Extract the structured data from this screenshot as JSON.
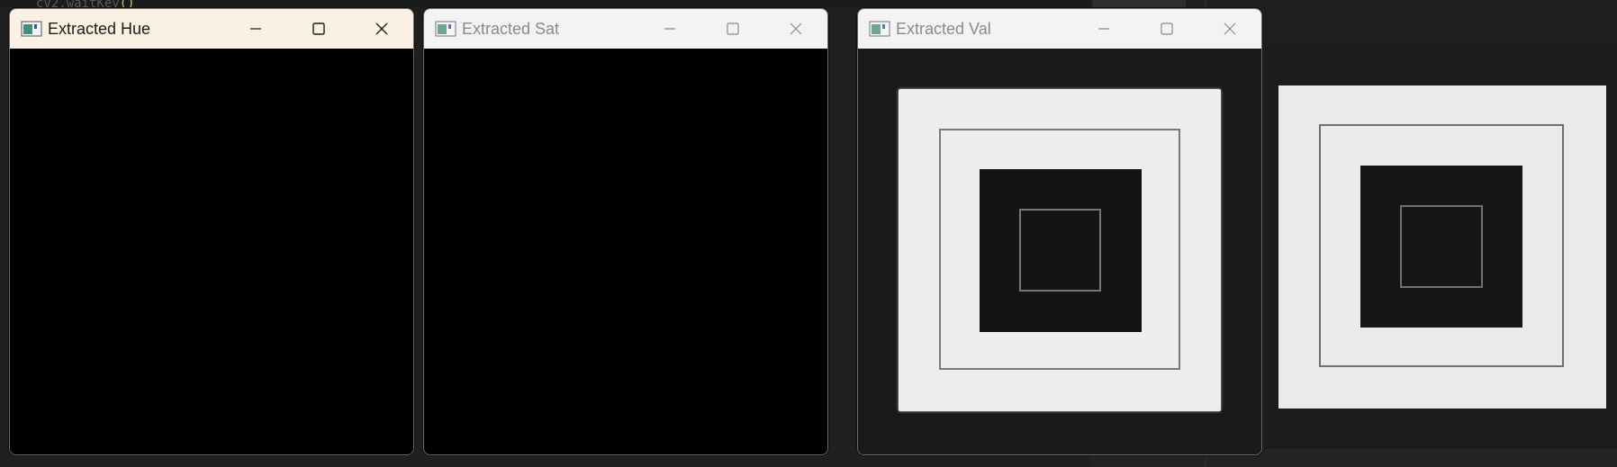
{
  "editor": {
    "code_fragment": "cv2.waitKey",
    "code_suffix": "()"
  },
  "windows": {
    "hue": {
      "title": "Extracted Hue",
      "active": true
    },
    "sat": {
      "title": "Extracted Sat",
      "active": false
    },
    "val": {
      "title": "Extracted Val",
      "active": false
    }
  },
  "icons": {
    "app": "opencv-window-icon",
    "minimize": "minimize-icon",
    "maximize": "maximize-icon",
    "close": "close-icon"
  },
  "colors": {
    "active_titlebar": "#fbf1e3",
    "inactive_titlebar": "#f3f3f3",
    "image_light": "#eeeeee",
    "image_dark": "#141414"
  }
}
